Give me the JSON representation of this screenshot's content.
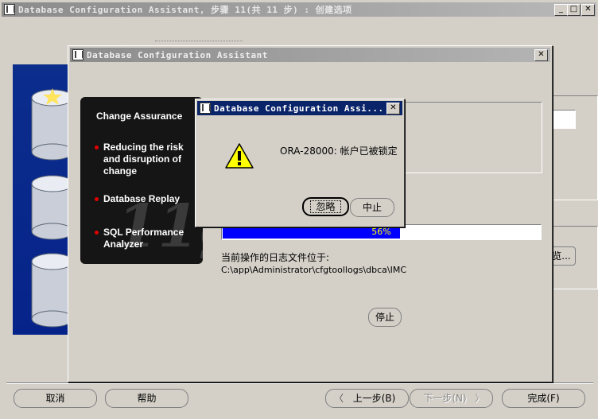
{
  "main_window": {
    "title": "Database Configuration Assistant, 步骤 11(共 11 步) : 创建选项",
    "buttons": {
      "cancel": "取消",
      "help": "帮助",
      "back": "上一步(B)",
      "next": "下一步(N)",
      "finish": "完成(F)"
    },
    "browse_partial": "览..."
  },
  "progress_window": {
    "title": "Database Configuration Assistant",
    "promo": {
      "heading": "Change Assurance",
      "items": [
        "Reducing the risk and disruption of change",
        "Database Replay",
        "SQL Performance Analyzer"
      ],
      "watermark": "11g"
    },
    "progress": {
      "percent": 56,
      "label": "56%"
    },
    "log_label": "当前操作的日志文件位于:",
    "log_path": "C:\\app\\Administrator\\cfgtoollogs\\dbca\\IMC",
    "stop_button": "停止"
  },
  "alert_dialog": {
    "title": "Database Configuration Assi...",
    "message": "ORA-28000: 帐户已被锁定",
    "icon": "warning-icon",
    "ignore_button": "忽略",
    "abort_button": "中止"
  },
  "colors": {
    "title_active": "#0a246a",
    "progress_fill": "#0000ff",
    "bullet_red": "#e00000",
    "promo_bg": "#1a1a1a"
  }
}
